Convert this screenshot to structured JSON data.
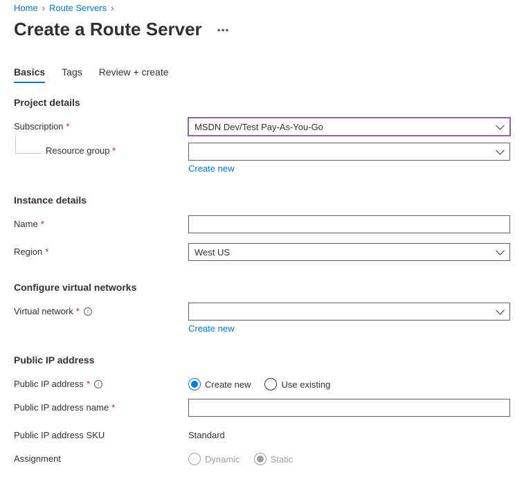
{
  "breadcrumb": {
    "items": [
      "Home",
      "Route Servers"
    ]
  },
  "header": {
    "title": "Create a Route Server"
  },
  "tabs": {
    "items": [
      {
        "label": "Basics",
        "active": true
      },
      {
        "label": "Tags",
        "active": false
      },
      {
        "label": "Review + create",
        "active": false
      }
    ]
  },
  "sections": {
    "project": {
      "heading": "Project details",
      "subscription_label": "Subscription",
      "subscription_value": "MSDN Dev/Test Pay-As-You-Go",
      "resource_group_label": "Resource group",
      "resource_group_value": "",
      "create_new": "Create new"
    },
    "instance": {
      "heading": "Instance details",
      "name_label": "Name",
      "name_value": "",
      "region_label": "Region",
      "region_value": "West US"
    },
    "vnet": {
      "heading": "Configure virtual networks",
      "vnet_label": "Virtual network",
      "vnet_value": "",
      "create_new": "Create new"
    },
    "publicip": {
      "heading": "Public IP address",
      "pip_label": "Public IP address",
      "pip_options": {
        "create_new": "Create new",
        "use_existing": "Use existing"
      },
      "pip_name_label": "Public IP address name",
      "pip_name_value": "",
      "pip_sku_label": "Public IP address SKU",
      "pip_sku_value": "Standard",
      "assignment_label": "Assignment",
      "assignment_options": {
        "dynamic": "Dynamic",
        "static": "Static"
      }
    }
  }
}
